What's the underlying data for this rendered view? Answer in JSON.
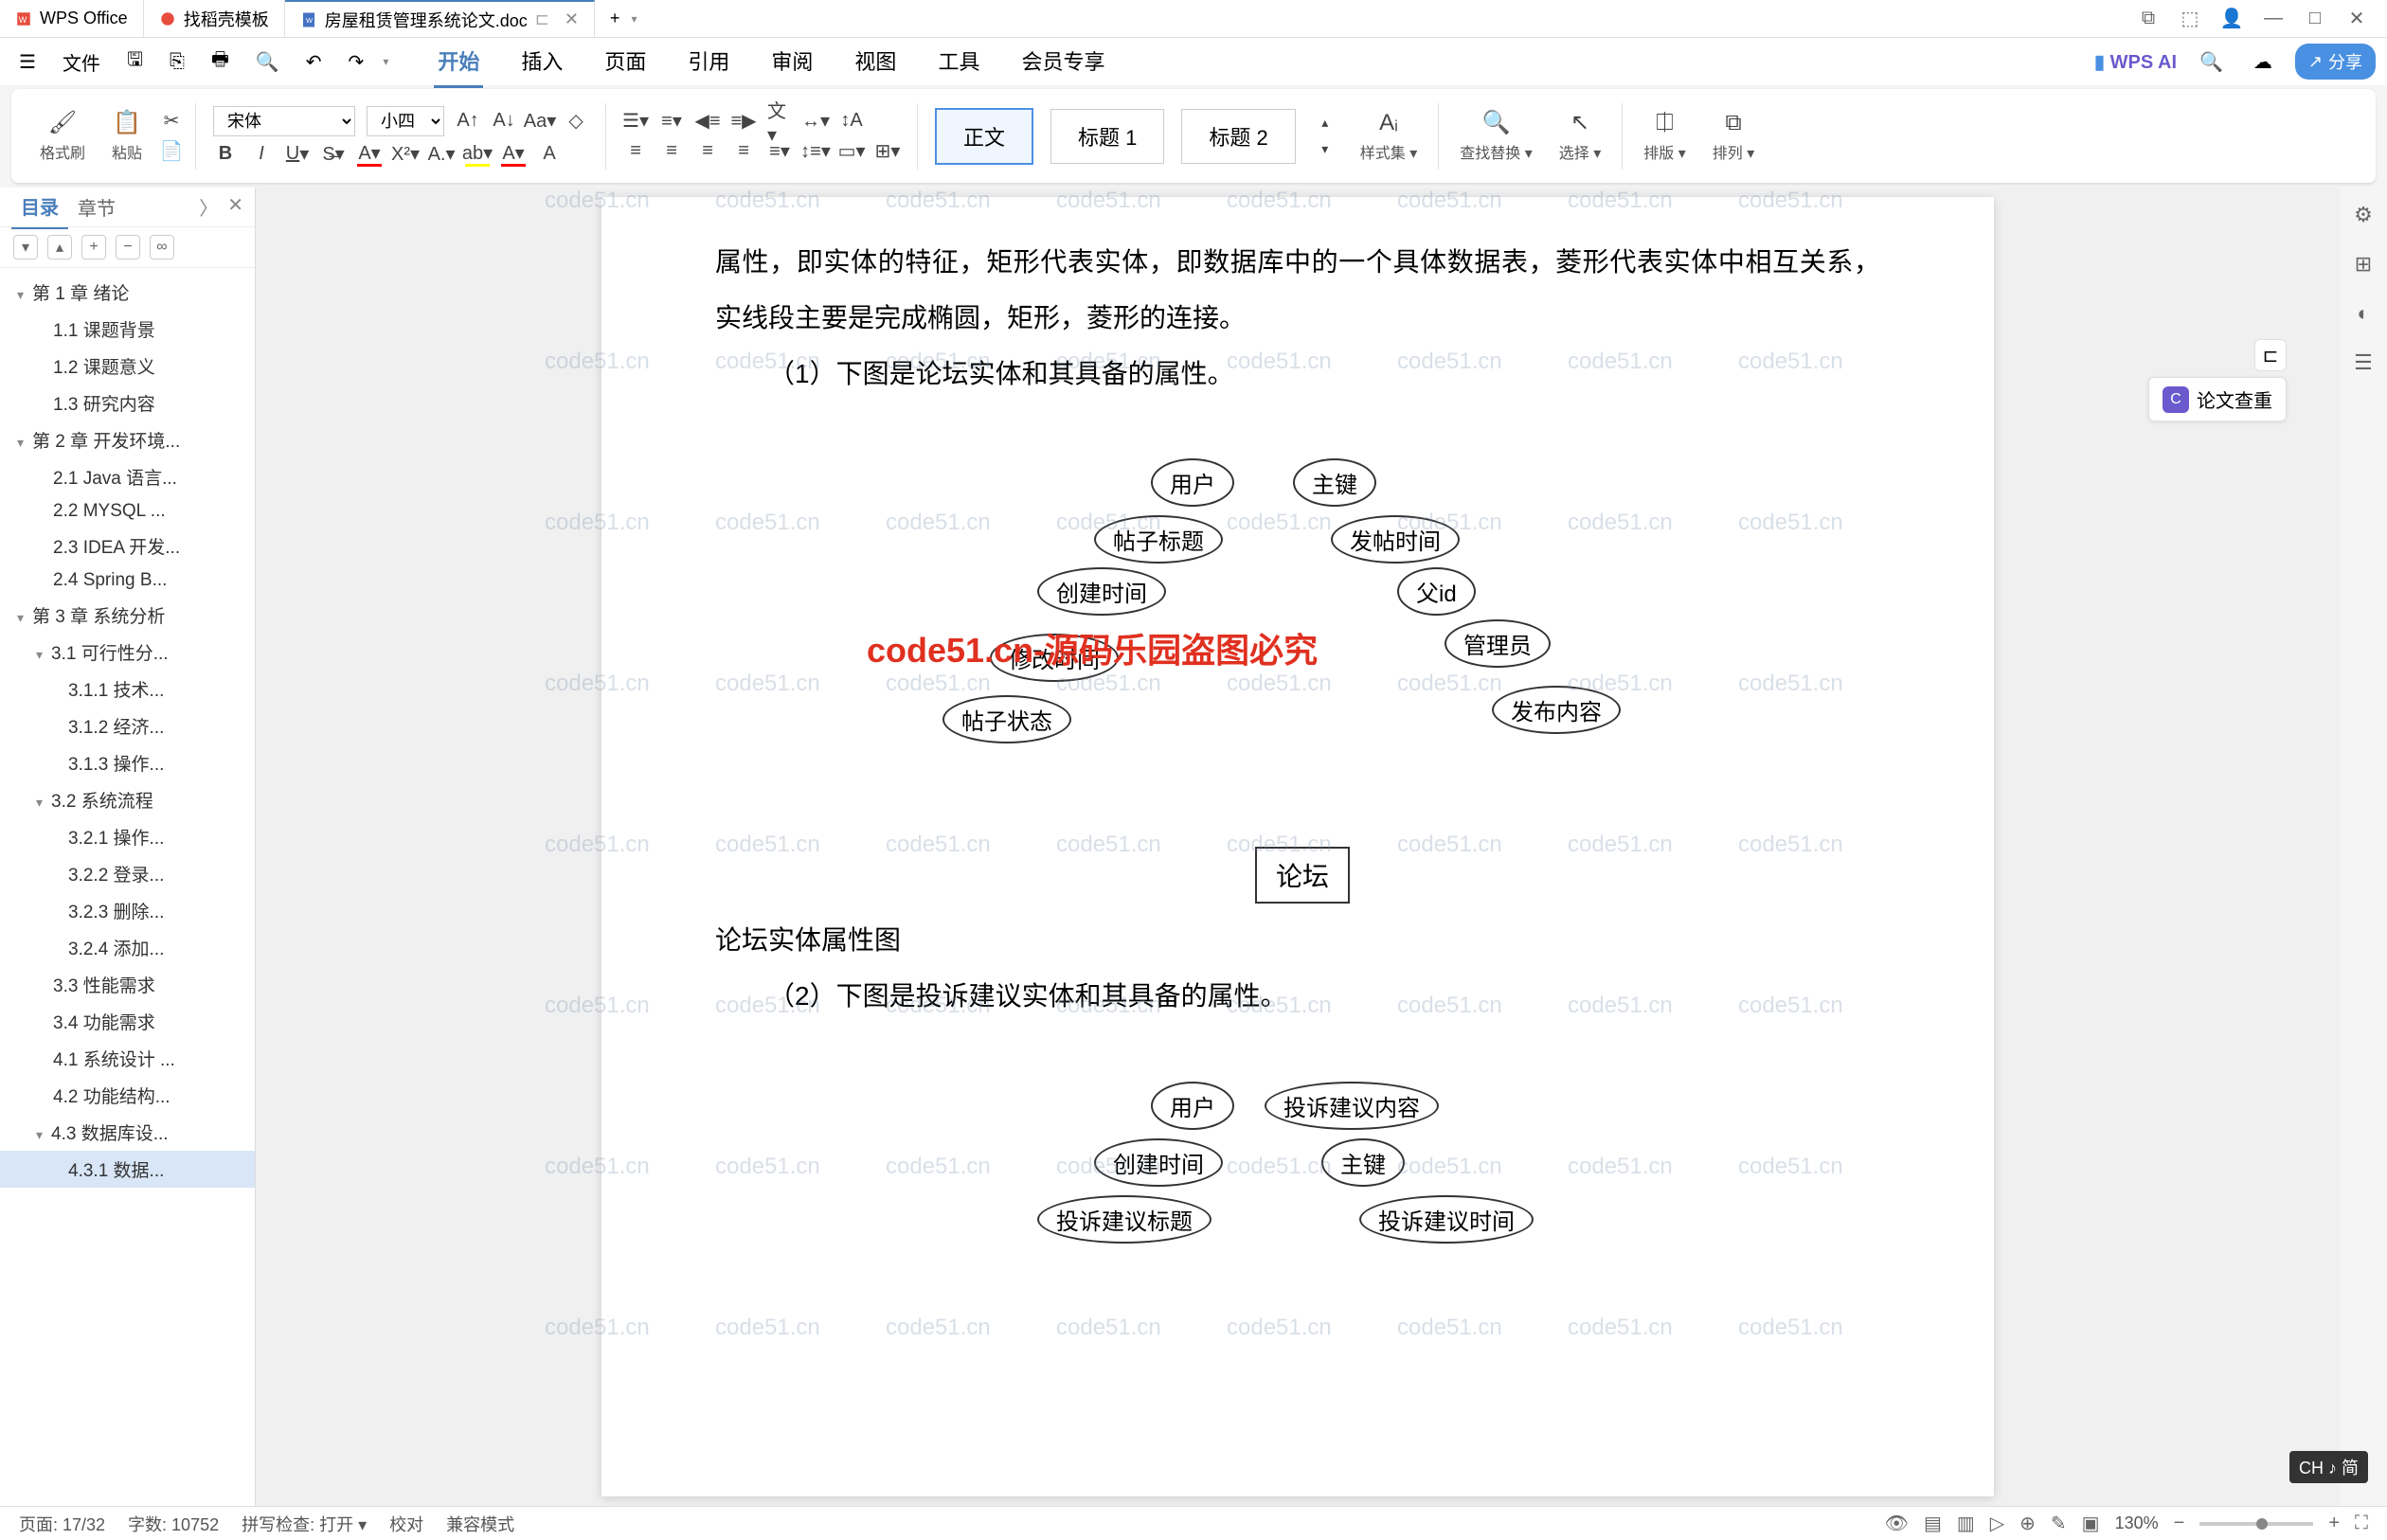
{
  "titlebar": {
    "app_name": "WPS Office",
    "tabs": [
      {
        "label": "找稻壳模板",
        "icon_color": "#e74c3c"
      },
      {
        "label": "房屋租赁管理系统论文.doc",
        "icon_color": "#4472c4",
        "active": true
      }
    ],
    "add_tab": "+"
  },
  "menubar": {
    "file_label": "文件",
    "tabs": [
      "开始",
      "插入",
      "页面",
      "引用",
      "审阅",
      "视图",
      "工具",
      "会员专享"
    ],
    "active_tab": "开始",
    "wps_ai": "WPS AI",
    "share": "分享"
  },
  "ribbon": {
    "brush": "格式刷",
    "paste": "粘贴",
    "font_name": "宋体",
    "font_size": "小四",
    "styles": {
      "normal": "正文",
      "h1": "标题 1",
      "h2": "标题 2"
    },
    "style_group": "样式集",
    "find": "查找替换",
    "select": "选择",
    "sort": "排版",
    "arrange": "排列"
  },
  "outline": {
    "tabs": {
      "contents": "目录",
      "sections": "章节"
    },
    "items": [
      {
        "t": "第 1 章 绪论",
        "l": 1,
        "exp": true
      },
      {
        "t": "1.1 课题背景",
        "l": 2
      },
      {
        "t": "1.2 课题意义",
        "l": 2
      },
      {
        "t": "1.3 研究内容",
        "l": 2
      },
      {
        "t": "第 2 章 开发环境...",
        "l": 1,
        "exp": true
      },
      {
        "t": "2.1 Java 语言...",
        "l": 2
      },
      {
        "t": "2.2 MYSQL ...",
        "l": 2
      },
      {
        "t": "2.3 IDEA 开发...",
        "l": 2
      },
      {
        "t": "2.4 Spring B...",
        "l": 2
      },
      {
        "t": "第 3 章 系统分析",
        "l": 1,
        "exp": true
      },
      {
        "t": "3.1 可行性分...",
        "l": 2,
        "exp": true
      },
      {
        "t": "3.1.1 技术...",
        "l": 3
      },
      {
        "t": "3.1.2 经济...",
        "l": 3
      },
      {
        "t": "3.1.3 操作...",
        "l": 3
      },
      {
        "t": "3.2 系统流程",
        "l": 2,
        "exp": true
      },
      {
        "t": "3.2.1 操作...",
        "l": 3
      },
      {
        "t": "3.2.2 登录...",
        "l": 3
      },
      {
        "t": "3.2.3 删除...",
        "l": 3
      },
      {
        "t": "3.2.4 添加...",
        "l": 3
      },
      {
        "t": "3.3 性能需求",
        "l": 2
      },
      {
        "t": "3.4 功能需求",
        "l": 2
      },
      {
        "t": "4.1 系统设计 ...",
        "l": 2
      },
      {
        "t": "4.2 功能结构...",
        "l": 2
      },
      {
        "t": "4.3 数据库设...",
        "l": 2,
        "exp": true
      },
      {
        "t": "4.3.1 数据...",
        "l": 3,
        "sel": true
      }
    ]
  },
  "document": {
    "para1": "属性，即实体的特征，矩形代表实体，即数据库中的一个具体数据表，菱形代表实体中相互关系，实线段主要是完成椭圆，矩形，菱形的连接。",
    "para2": "（1）下图是论坛实体和其具备的属性。",
    "er1": {
      "entity": "论坛",
      "attrs": [
        "用户",
        "主键",
        "帖子标题",
        "发帖时间",
        "创建时间",
        "父id",
        "修改时间",
        "管理员",
        "帖子状态",
        "发布内容"
      ],
      "caption": "论坛实体属性图"
    },
    "para3": "（2）下图是投诉建议实体和其具备的属性。",
    "er2": {
      "attrs": [
        "用户",
        "投诉建议内容",
        "创建时间",
        "主键",
        "投诉建议标题",
        "投诉建议时间"
      ]
    },
    "watermark": "code51.cn",
    "watermark_red": "code51.cn-源码乐园盗图必究"
  },
  "right_rail": {
    "lunwen": "论文查重"
  },
  "statusbar": {
    "page": "页面: 17/32",
    "words": "字数: 10752",
    "spellcheck": "拼写检查: 打开",
    "proof": "校对",
    "compat": "兼容模式",
    "zoom": "130%"
  },
  "ime": {
    "label": "CH ♪ 简"
  }
}
